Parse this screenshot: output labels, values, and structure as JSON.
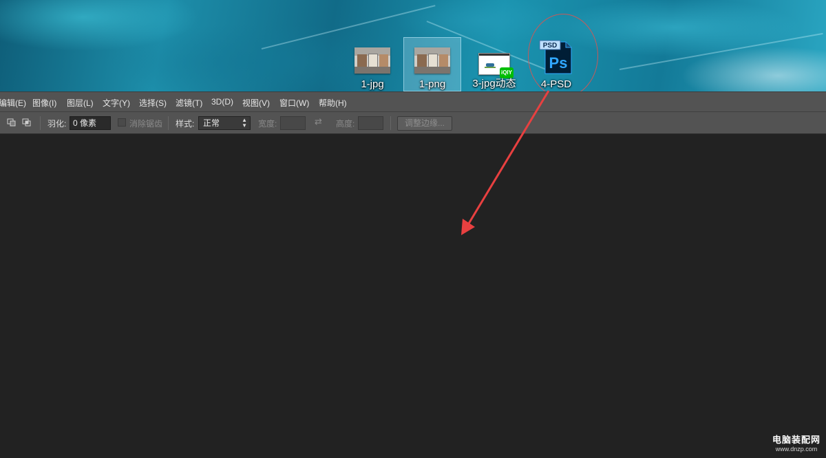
{
  "desktop": {
    "icons": [
      {
        "label": "1-jpg",
        "selected": false
      },
      {
        "label": "1-png",
        "selected": true
      },
      {
        "label": "3-jpg动态",
        "selected": false
      },
      {
        "label": "4-PSD",
        "selected": false,
        "badge": "PSD",
        "logo": "Ps"
      }
    ]
  },
  "menubar": {
    "items": [
      "编辑(E)",
      "图像(I)",
      "图层(L)",
      "文字(Y)",
      "选择(S)",
      "滤镜(T)",
      "3D(D)",
      "视图(V)",
      "窗口(W)",
      "帮助(H)"
    ]
  },
  "options": {
    "feather_label": "羽化:",
    "feather_value": "0 像素",
    "antialias_label": "消除锯齿",
    "style_label": "样式:",
    "style_value": "正常",
    "width_label": "宽度:",
    "height_label": "高度:",
    "refine_button": "调整边缘..."
  },
  "watermark": {
    "name": "电脑装配网",
    "url": "www.dnzp.com"
  },
  "colors": {
    "annotation_red": "#e84040",
    "panel_gray": "#535353",
    "canvas_dark": "#222222"
  }
}
